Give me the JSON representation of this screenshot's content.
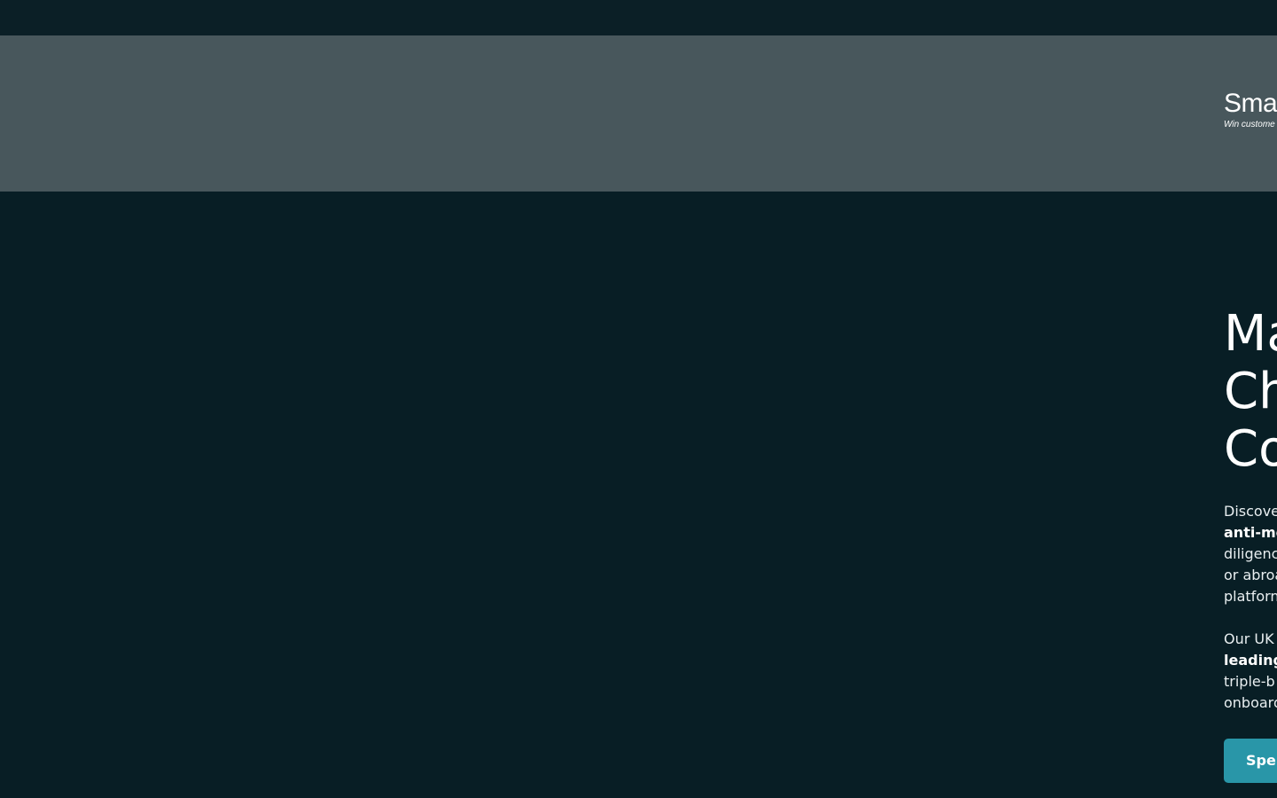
{
  "header": {
    "logo_name": "Sma",
    "logo_tagline": "Win custome"
  },
  "hero": {
    "title_lines": [
      "Ma",
      "Ch",
      "Co"
    ],
    "paragraph1_lines": [
      "Discove",
      "anti-mo",
      "diligenc",
      "or abroa",
      "platforn"
    ],
    "paragraph2_lines": [
      "Our UK",
      "leading",
      "triple-b",
      "onboard"
    ],
    "cta_label": "Spe"
  },
  "colors": {
    "page_bg": "#081e25",
    "header_bg": "#48575c",
    "accent": "#2996a8"
  }
}
